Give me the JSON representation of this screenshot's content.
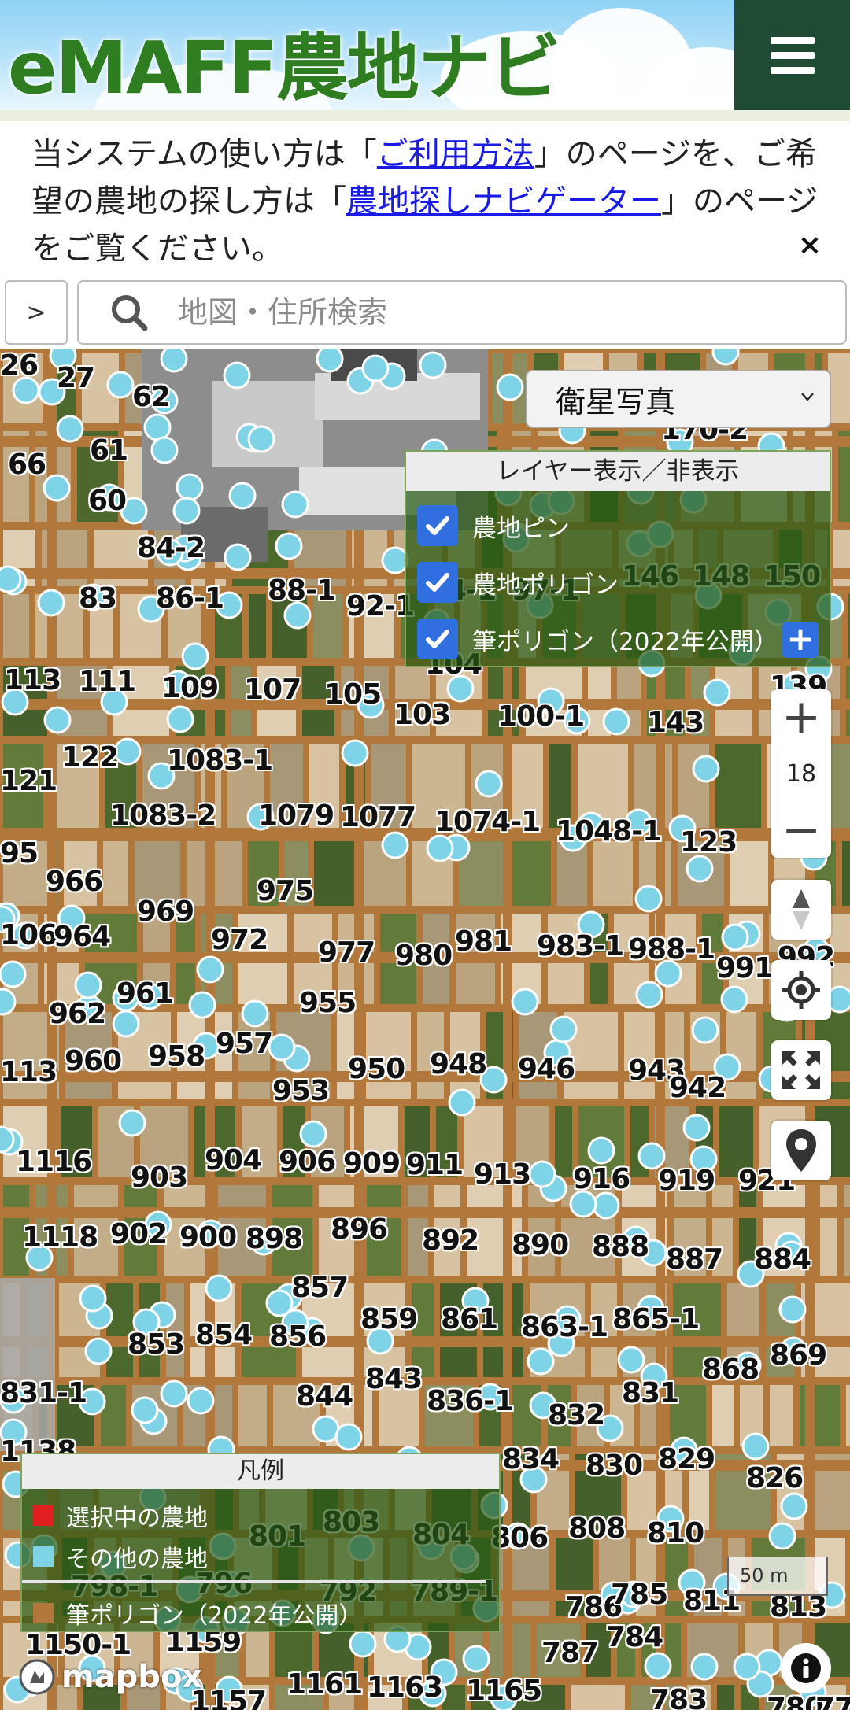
{
  "header": {
    "logo_text": "eMAFF農地ナビ",
    "menu_icon": "hamburger-icon"
  },
  "notice": {
    "text_1": "当システムの使い方は「",
    "link_usage": "ご利用方法",
    "text_2": "」のページを、ご希望の農地の探し方は「",
    "link_navigator": "農地探しナビゲーター",
    "text_3": "」のページをご覧ください。",
    "close_label": "×"
  },
  "search": {
    "toggle_label": ">",
    "placeholder": "地図・住所検索",
    "icon": "search-icon"
  },
  "map": {
    "basemap_selected": "衛星写真",
    "zoom_in_label": "+",
    "zoom_level": "18",
    "zoom_out_label": "−",
    "scale_label": "50 m",
    "attribution": "mapbox",
    "info_label": "i",
    "lot_numbers": [
      "26",
      "27",
      "62",
      "66",
      "61",
      "60",
      "84-2",
      "83",
      "86-1",
      "88-1",
      "92-1",
      "94-1",
      "97-1",
      "104",
      "146",
      "148",
      "150",
      "170-2",
      "113",
      "111",
      "109",
      "107",
      "105",
      "103",
      "100-1",
      "143",
      "139",
      "122",
      "1083-1",
      "121",
      "1083-2",
      "1079",
      "1077",
      "1074-1",
      "1048-1",
      "123",
      "95",
      "966",
      "975",
      "969",
      "106",
      "964",
      "972",
      "977",
      "980",
      "981",
      "983-1",
      "988-1",
      "991",
      "992",
      "961",
      "955",
      "962",
      "957",
      "958",
      "960",
      "113",
      "950",
      "948",
      "946",
      "943",
      "942",
      "953",
      "1116",
      "904",
      "906",
      "909",
      "911",
      "913",
      "903",
      "916",
      "919",
      "921",
      "1118",
      "902",
      "900",
      "898",
      "896",
      "892",
      "890",
      "888",
      "887",
      "884",
      "857",
      "859",
      "861",
      "863-1",
      "865-1",
      "853",
      "854",
      "856",
      "869",
      "868",
      "831-1",
      "843",
      "844",
      "836-1",
      "832",
      "831",
      "1138",
      "834",
      "830",
      "829",
      "826",
      "803",
      "801",
      "804",
      "806",
      "808",
      "810",
      "789-1",
      "786",
      "785",
      "811",
      "813",
      "798-1",
      "796",
      "792",
      "787",
      "784",
      "1150-1",
      "1159",
      "1161",
      "1163",
      "1165",
      "1157",
      "783",
      "780",
      "77"
    ]
  },
  "layer_panel": {
    "title": "レイヤー表示／非表示",
    "layers": [
      {
        "label": "農地ピン",
        "checked": true
      },
      {
        "label": "農地ポリゴン",
        "checked": true
      },
      {
        "label": "筆ポリゴン（2022年公開）",
        "checked": true
      }
    ],
    "expand_label": "+"
  },
  "legend": {
    "title": "凡例",
    "items": [
      {
        "label": "選択中の農地",
        "color": "#e02020"
      },
      {
        "label": "その他の農地",
        "color": "#7fd3e6"
      },
      {
        "label": "筆ポリゴン（2022年公開）",
        "color": "#b2773b"
      }
    ]
  },
  "colors": {
    "header_menu_bg": "#1f4a34",
    "logo_green": "#2e7d21",
    "link_blue": "#1a1ae6",
    "checkbox_blue": "#2f6fe0",
    "parcel_brown": "#b2773b",
    "pin_cyan": "#7fd3e6"
  }
}
